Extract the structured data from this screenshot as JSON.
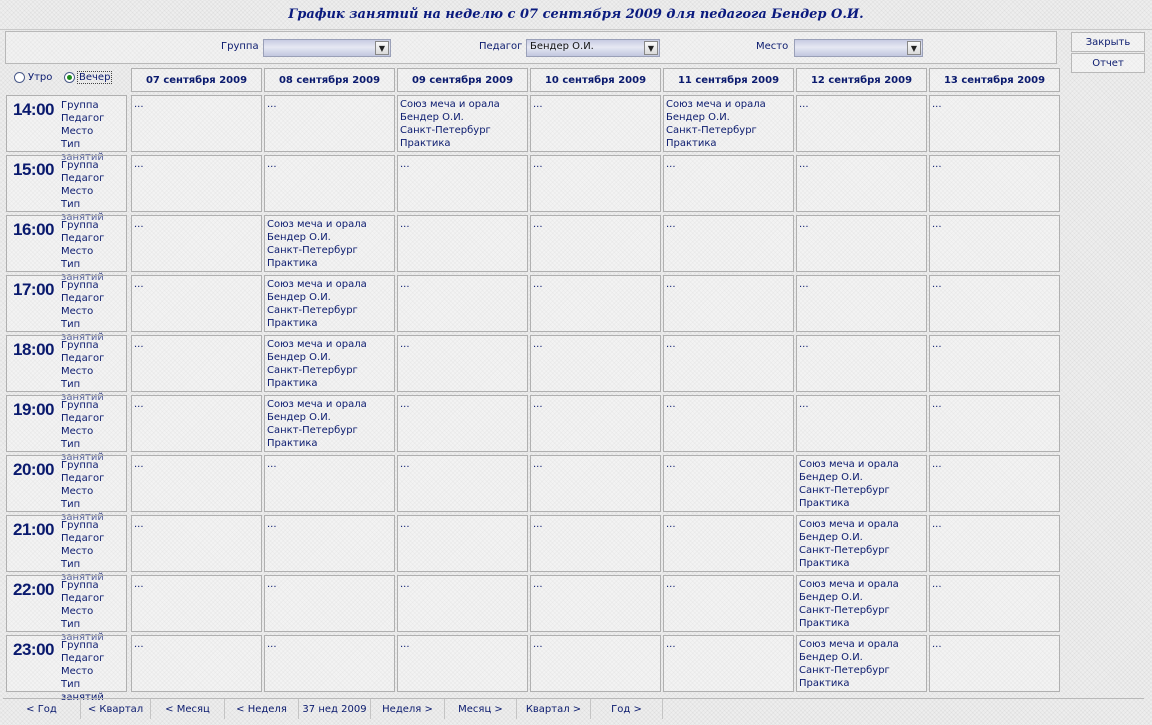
{
  "title": "График занятий на неделю с 07 сентября 2009 для педагога Бендер О.И.",
  "filters": {
    "group_label": "Группа",
    "group_value": "",
    "teacher_label": "Педагог",
    "teacher_value": "Бендер О.И.",
    "place_label": "Место",
    "place_value": ""
  },
  "actions": {
    "close": "Закрыть",
    "report": "Отчет"
  },
  "period": {
    "morning": "Утро",
    "evening": "Вечер",
    "selected": "evening"
  },
  "days": [
    "07 сентября 2009",
    "08 сентября 2009",
    "09 сентября 2009",
    "10 сентября 2009",
    "11 сентября 2009",
    "12 сентября 2009",
    "13 сентября 2009"
  ],
  "slot_labels": [
    "Группа",
    "Педагог",
    "Место",
    "Тип занятий"
  ],
  "empty_text": "...",
  "lesson": [
    "Союз меча и орала",
    "Бендер О.И.",
    "Санкт-Петербург",
    "Практика"
  ],
  "schedule": [
    {
      "time": "14:00",
      "lessons": [
        0,
        0,
        1,
        0,
        1,
        0,
        0
      ]
    },
    {
      "time": "15:00",
      "lessons": [
        0,
        0,
        0,
        0,
        0,
        0,
        0
      ]
    },
    {
      "time": "16:00",
      "lessons": [
        0,
        1,
        0,
        0,
        0,
        0,
        0
      ]
    },
    {
      "time": "17:00",
      "lessons": [
        0,
        1,
        0,
        0,
        0,
        0,
        0
      ]
    },
    {
      "time": "18:00",
      "lessons": [
        0,
        1,
        0,
        0,
        0,
        0,
        0
      ]
    },
    {
      "time": "19:00",
      "lessons": [
        0,
        1,
        0,
        0,
        0,
        0,
        0
      ]
    },
    {
      "time": "20:00",
      "lessons": [
        0,
        0,
        0,
        0,
        0,
        1,
        0
      ]
    },
    {
      "time": "21:00",
      "lessons": [
        0,
        0,
        0,
        0,
        0,
        1,
        0
      ]
    },
    {
      "time": "22:00",
      "lessons": [
        0,
        0,
        0,
        0,
        0,
        1,
        0
      ]
    },
    {
      "time": "23:00",
      "lessons": [
        0,
        0,
        0,
        0,
        0,
        1,
        0
      ]
    }
  ],
  "nav": {
    "prev_year": "< Год",
    "prev_quarter": "< Квартал",
    "prev_month": "< Месяц",
    "prev_week": "< Неделя",
    "current_week": "37 нед 2009",
    "next_week": "Неделя >",
    "next_month": "Месяц >",
    "next_quarter": "Квартал >",
    "next_year": "Год >"
  }
}
